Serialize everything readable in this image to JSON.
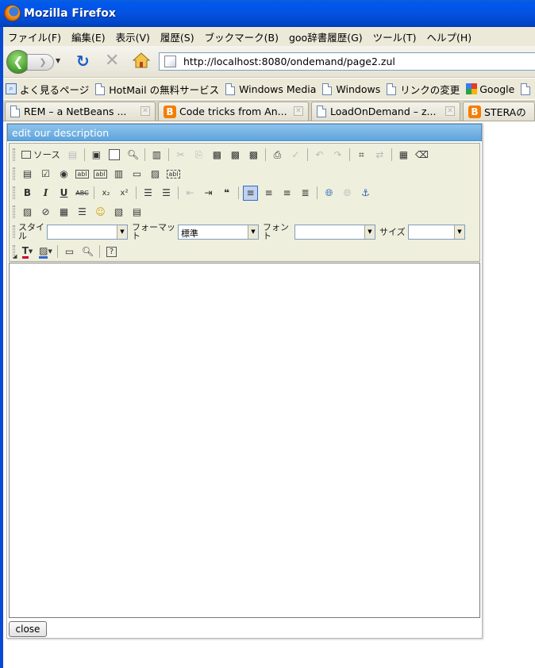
{
  "window": {
    "title": "Mozilla Firefox"
  },
  "menubar": [
    "ファイル(F)",
    "編集(E)",
    "表示(V)",
    "履歴(S)",
    "ブックマーク(B)",
    "goo辞書履歴(G)",
    "ツール(T)",
    "ヘルプ(H)"
  ],
  "nav": {
    "url": "http://localhost:8080/ondemand/page2.zul"
  },
  "bookmarks": [
    {
      "label": "よく見るページ",
      "icon": "frequent-pages-icon"
    },
    {
      "label": "HotMail の無料サービス",
      "icon": "page-icon"
    },
    {
      "label": "Windows Media",
      "icon": "page-icon"
    },
    {
      "label": "Windows",
      "icon": "page-icon"
    },
    {
      "label": "リンクの変更",
      "icon": "page-icon"
    },
    {
      "label": "Google",
      "icon": "google-icon"
    }
  ],
  "tabs": [
    {
      "label": "REM – a NetBeans ...",
      "icon": "page-icon"
    },
    {
      "label": "Code tricks from An...",
      "icon": "blogger-icon"
    },
    {
      "label": "LoadOnDemand – z...",
      "icon": "page-icon"
    },
    {
      "label": "STERAの",
      "icon": "blogger-icon"
    }
  ],
  "dialog": {
    "title": "edit our description",
    "close_label": "close",
    "toolbar": {
      "source_label": "ソース",
      "style_label": "スタイル",
      "format_label": "フォーマット",
      "format_value": "標準",
      "font_label": "フォント",
      "size_label": "サイズ"
    }
  }
}
